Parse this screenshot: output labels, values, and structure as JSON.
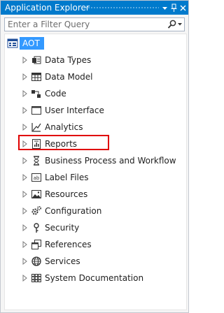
{
  "window": {
    "title": "Application Explorer"
  },
  "search": {
    "placeholder": "Enter a Filter Query"
  },
  "tree": {
    "root": {
      "label": "AOT",
      "icon": "aot-root-icon"
    },
    "items": [
      {
        "label": "Data Types",
        "icon": "data-types-icon"
      },
      {
        "label": "Data Model",
        "icon": "data-model-icon"
      },
      {
        "label": "Code",
        "icon": "code-icon"
      },
      {
        "label": "User Interface",
        "icon": "user-interface-icon"
      },
      {
        "label": "Analytics",
        "icon": "analytics-icon"
      },
      {
        "label": "Reports",
        "icon": "reports-icon"
      },
      {
        "label": "Business Process and Workflow",
        "icon": "workflow-icon"
      },
      {
        "label": "Label Files",
        "icon": "label-files-icon"
      },
      {
        "label": "Resources",
        "icon": "resources-icon"
      },
      {
        "label": "Configuration",
        "icon": "configuration-icon"
      },
      {
        "label": "Security",
        "icon": "security-icon"
      },
      {
        "label": "References",
        "icon": "references-icon"
      },
      {
        "label": "Services",
        "icon": "services-icon"
      },
      {
        "label": "System Documentation",
        "icon": "system-documentation-icon"
      }
    ]
  },
  "colors": {
    "titlebar": "#007acc",
    "selection": "#3399ff",
    "highlight": "#e00000"
  }
}
